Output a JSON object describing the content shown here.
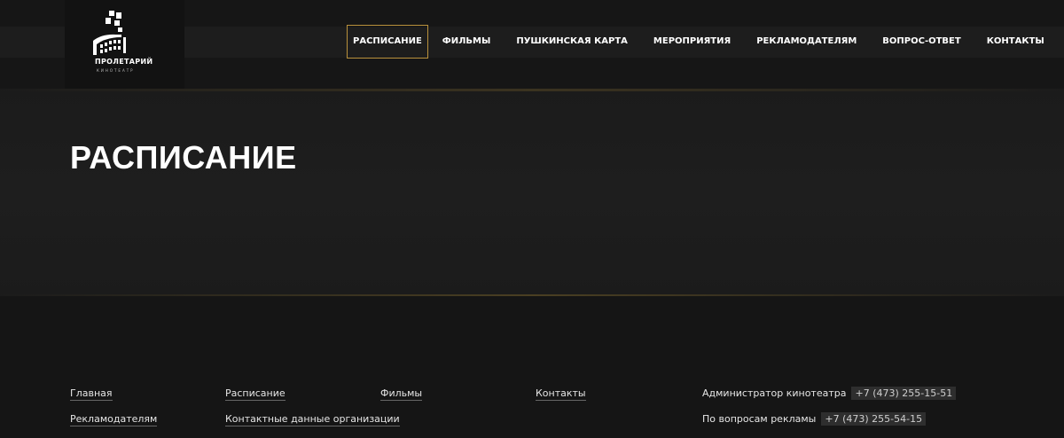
{
  "logo": {
    "name": "ПРОЛЕТАРИЙ",
    "sub": "КИНОТЕАТР"
  },
  "nav": {
    "items": [
      {
        "label": "РАСПИСАНИЕ",
        "active": true
      },
      {
        "label": "ФИЛЬМЫ"
      },
      {
        "label": "ПУШКИНСКАЯ КАРТА"
      },
      {
        "label": "МЕРОПРИЯТИЯ"
      },
      {
        "label": "РЕКЛАМОДАТЕЛЯМ"
      },
      {
        "label": "ВОПРОС-ОТВЕТ"
      },
      {
        "label": "КОНТАКТЫ"
      }
    ]
  },
  "hero": {
    "title": "РАСПИСАНИЕ"
  },
  "footer": {
    "links": {
      "home": "Главная",
      "schedule": "Расписание",
      "films": "Фильмы",
      "contacts": "Контакты",
      "advertisers": "Рекламодателям",
      "org_contacts": "Контактные данные организации"
    },
    "contacts": [
      {
        "label": "Администратор кинотеатра",
        "phone": "+7 (473) 255-15-51"
      },
      {
        "label": "По вопросам рекламы",
        "phone": "+7 (473) 255-54-15"
      }
    ]
  },
  "colors": {
    "accent": "#b9913c",
    "background": "#151515",
    "hero": "#1e1e1e"
  }
}
